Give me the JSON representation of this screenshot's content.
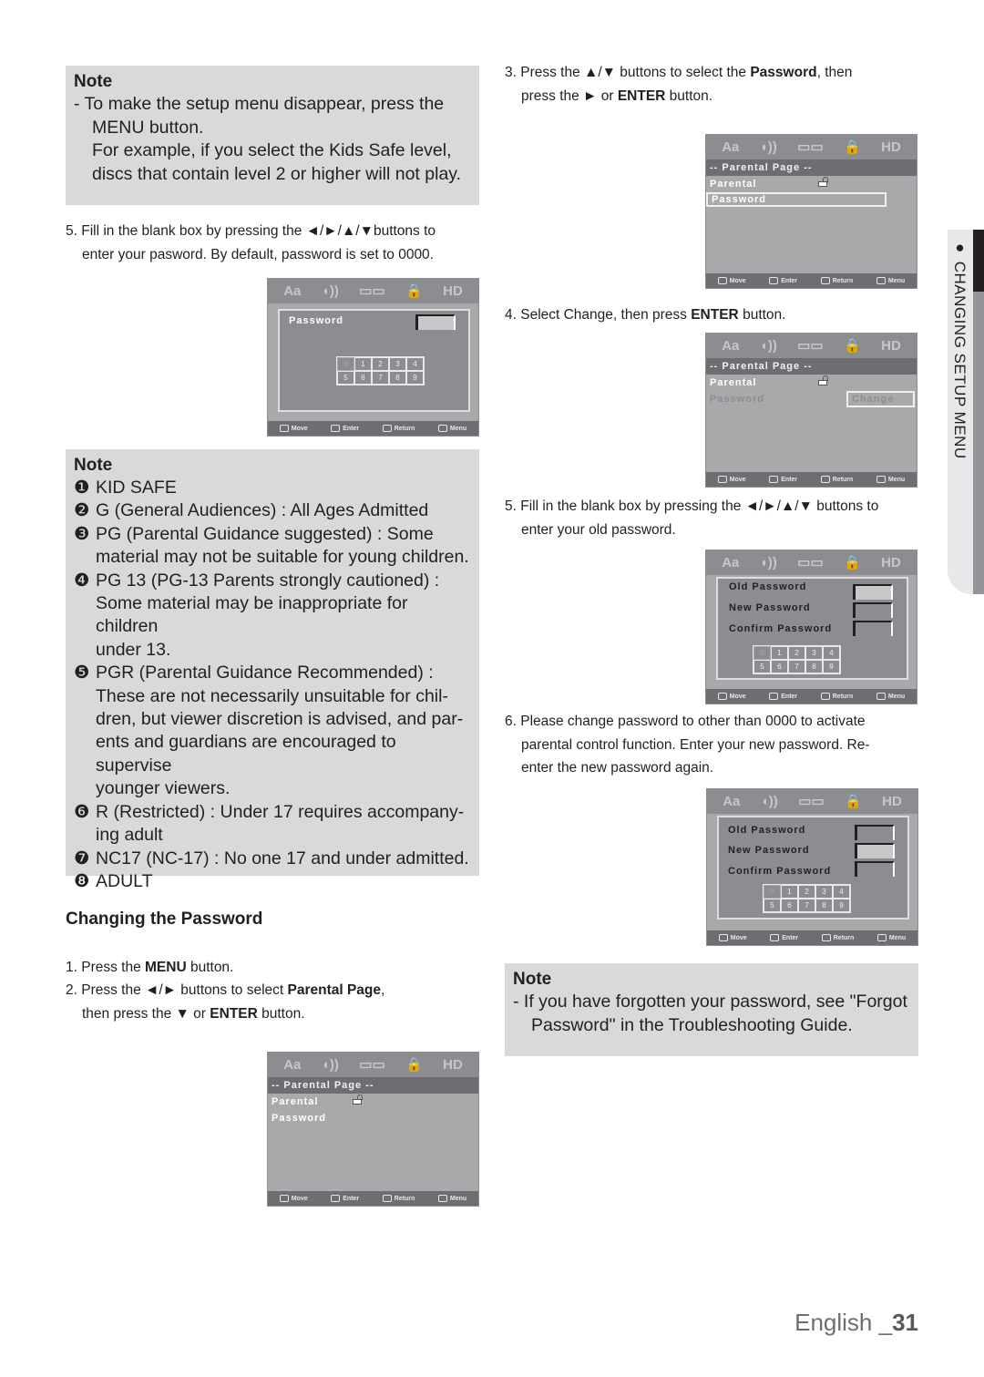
{
  "left": {
    "note1": {
      "title": "Note",
      "line1": "- To make the setup menu disappear, press the",
      "line2": "MENU button.",
      "line3": "For example, if you select the Kids Safe level,",
      "line4": "discs that contain level 2 or higher will not play."
    },
    "step5": {
      "prefix": "5. Fill in the blank box by pressing the ",
      "arrows": "◄/►/▲/▼",
      "suffix": "buttons to",
      "line2": "enter your pasword. By default, password is set to 0000."
    },
    "note2": {
      "title": "Note",
      "items": [
        {
          "num": "❶",
          "lines": [
            "KID SAFE"
          ]
        },
        {
          "num": "❷",
          "lines": [
            "G (General Audiences) : All Ages Admitted"
          ]
        },
        {
          "num": "❸",
          "lines": [
            "PG (Parental Guidance suggested) : Some",
            "material may not be suitable for young children."
          ]
        },
        {
          "num": "❹",
          "lines": [
            "PG 13 (PG-13 Parents strongly cautioned) :",
            "Some material may be inappropriate for children",
            "under 13."
          ]
        },
        {
          "num": "❺",
          "lines": [
            "PGR (Parental Guidance Recommended) :",
            "These are not necessarily unsuitable for chil-",
            "dren, but viewer discretion is advised, and par-",
            "ents and guardians are encouraged to supervise",
            "younger viewers."
          ]
        },
        {
          "num": "❻",
          "lines": [
            "R (Restricted) : Under 17 requires accompany-",
            "ing adult"
          ]
        },
        {
          "num": "❼",
          "lines": [
            "NC17 (NC-17) : No one 17 and under admitted."
          ]
        },
        {
          "num": "❽",
          "lines": [
            "ADULT"
          ]
        }
      ]
    },
    "section_title": "Changing the Password",
    "cp_step1": {
      "prefix": "1. Press the ",
      "bold": "MENU",
      "suffix": " button."
    },
    "cp_step2": {
      "prefix": "2. Press the ◄/► buttons to select ",
      "bold": "Parental Page",
      "suffix": ",",
      "line2_prefix": "then press the ▼ or ",
      "line2_bold": "ENTER",
      "line2_suffix": " button."
    }
  },
  "right": {
    "step3": {
      "prefix": "3. Press the ▲/▼ buttons to select the ",
      "bold": "Password",
      "suffix": ", then",
      "line2_prefix": "press the ► or ",
      "line2_bold": "ENTER",
      "line2_suffix": " button."
    },
    "step4": {
      "prefix": "4. Select Change, then press ",
      "bold": "ENTER",
      "suffix": " button."
    },
    "step5": {
      "line1": "5. Fill in the blank box by pressing the ◄/►/▲/▼ buttons to",
      "line2": "enter your old password."
    },
    "step6": {
      "line1": "6. Please change password to other than 0000 to activate",
      "line2": "parental control function. Enter your new password. Re-",
      "line3": "enter the new password again."
    },
    "note3": {
      "title": "Note",
      "line1": "- If you have forgotten your password, see \"Forgot",
      "line2": "Password\" in the Troubleshooting Guide."
    }
  },
  "tv": {
    "top_icons": [
      "Aa",
      "◖))",
      "▭▭",
      "🔒",
      "HD"
    ],
    "bottom": [
      "Move",
      "Enter",
      "Return",
      "Menu"
    ],
    "parental_page": "-- Parental Page --",
    "parental": "Parental",
    "password": "Password",
    "change": "Change",
    "old_password": "Old Password",
    "new_password": "New Password",
    "confirm_password": "Confirm Password",
    "keys": [
      "0",
      "1",
      "2",
      "3",
      "4",
      "5",
      "6",
      "7",
      "8",
      "9"
    ]
  },
  "side_tab": "● CHANGING SETUP MENU",
  "footer": {
    "lang": "English _",
    "page": "31"
  }
}
